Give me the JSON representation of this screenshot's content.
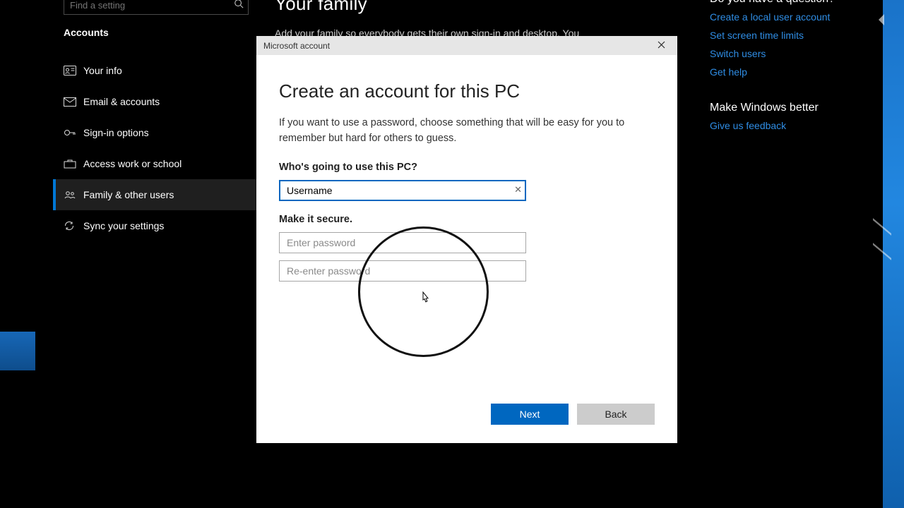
{
  "settings": {
    "search_placeholder": "Find a setting",
    "section_title": "Accounts",
    "nav": [
      {
        "label": "Your info"
      },
      {
        "label": "Email & accounts"
      },
      {
        "label": "Sign-in options"
      },
      {
        "label": "Access work or school"
      },
      {
        "label": "Family & other users"
      },
      {
        "label": "Sync your settings"
      }
    ],
    "content": {
      "heading": "Your family",
      "body": "Add your family so everybody gets their own sign-in and desktop. You"
    },
    "help": {
      "question_heading": "Do you have a question?",
      "links": [
        "Create a local user account",
        "Set screen time limits",
        "Switch users",
        "Get help"
      ],
      "improve_heading": "Make Windows better",
      "feedback_link": "Give us feedback"
    }
  },
  "dialog": {
    "window_title": "Microsoft account",
    "heading": "Create an account for this PC",
    "intro": "If you want to use a password, choose something that will be easy for you to remember but hard for others to guess.",
    "who_label": "Who's going to use this PC?",
    "username_value": "Username",
    "secure_label": "Make it secure.",
    "password_placeholder": "Enter password",
    "password2_placeholder": "Re-enter password",
    "next_label": "Next",
    "back_label": "Back"
  }
}
